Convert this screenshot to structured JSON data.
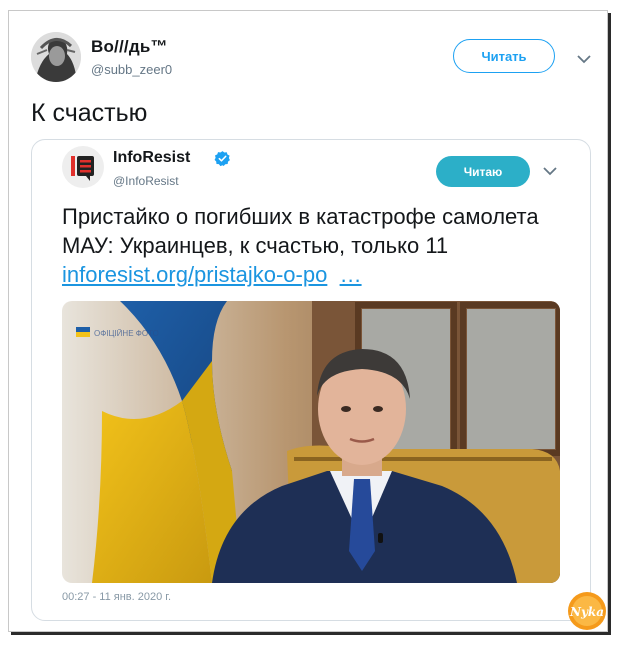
{
  "tweet": {
    "author_name": "Во///дь™",
    "author_handle": "@subb_zeer0",
    "follow_label": "Читать",
    "text": "К счастью"
  },
  "quoted": {
    "author_name": "InfoResist",
    "author_handle": "@InfoResist",
    "following_label": "Читаю",
    "text": "Пристайко о погибших в катастрофе самолета МАУ: Украинцев, к счастью, только 11 ",
    "link_text": "inforesist.org/pristajko-o-po",
    "ellipsis": "…",
    "media_watermark": "ОФІЦІЙНЕ ФОТО",
    "timestamp": "00:27 - 11 янв. 2020 г."
  },
  "watermark": {
    "text": "Nyka"
  },
  "colors": {
    "accent": "#1da1f2",
    "following_bg": "#2cafc8",
    "verified": "#1da1f2",
    "link": "#1b95e0"
  },
  "icons": {
    "menu": "chevron-down-icon",
    "verified": "verified-badge-icon",
    "brand": "inforesist-logo-icon"
  }
}
